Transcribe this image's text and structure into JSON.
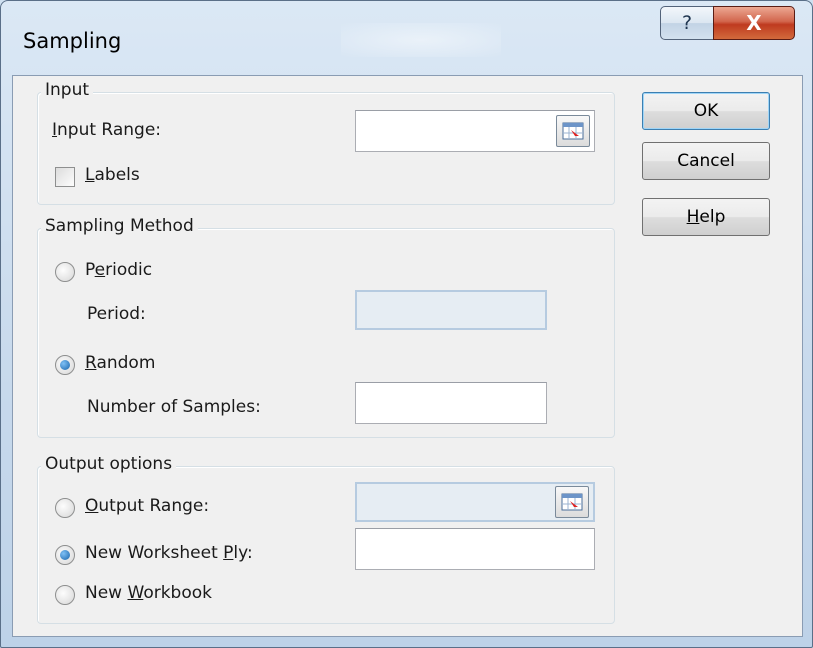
{
  "window": {
    "title": "Sampling",
    "help_glyph": "?",
    "close_glyph": "X"
  },
  "input_group": {
    "label": "Input",
    "input_range_label": {
      "key": "I",
      "rest": "nput Range:"
    },
    "input_range_value": "",
    "labels_checkbox": {
      "key": "L",
      "rest": "abels",
      "checked": false
    }
  },
  "method_group": {
    "label": "Sampling Method",
    "periodic": {
      "pre": "P",
      "key": "e",
      "rest": "riodic",
      "selected": false
    },
    "period_label": "Period:",
    "period_value": "",
    "random": {
      "key": "R",
      "rest": "andom",
      "selected": true
    },
    "samples_label": "Number of Samples:",
    "samples_value": ""
  },
  "output_group": {
    "label": "Output options",
    "output_range": {
      "key": "O",
      "rest": "utput Range:",
      "selected": false
    },
    "output_range_value": "",
    "new_ply": {
      "pre": "New Worksheet ",
      "key": "P",
      "rest": "ly:",
      "selected": true
    },
    "new_ply_value": "",
    "new_workbook": {
      "pre": "New ",
      "key": "W",
      "rest": "orkbook",
      "selected": false
    }
  },
  "buttons": {
    "ok": "OK",
    "cancel": "Cancel",
    "help": {
      "key": "H",
      "rest": "elp"
    }
  },
  "icons": {
    "range_selector": "range-select-icon",
    "help": "question-icon",
    "close": "close-icon"
  }
}
